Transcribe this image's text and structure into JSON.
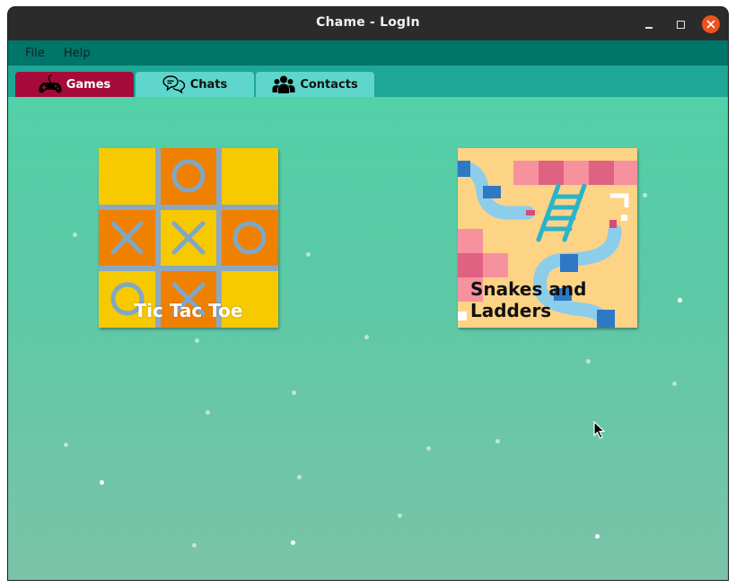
{
  "window": {
    "title": "Chame - LogIn"
  },
  "menu": {
    "file": "File",
    "help": "Help"
  },
  "tabs": {
    "games": "Games",
    "chats": "Chats",
    "contacts": "Contacts"
  },
  "games": [
    {
      "label": "Tic Tac Toe"
    },
    {
      "label": "Snakes and Ladders"
    }
  ],
  "colors": {
    "titlebar": "#2b2b2b",
    "menubar": "#00756a",
    "tabbar": "#1ea697",
    "active_tab": "#a60a3a",
    "inactive_tab": "#5fd6cb",
    "close_button": "#e95420",
    "content_top": "#52d0a7",
    "content_bottom": "#7bc3a9"
  },
  "icons": {
    "games_tab": "gamepad-icon",
    "chats_tab": "chat-bubbles-icon",
    "contacts_tab": "people-group-icon"
  }
}
